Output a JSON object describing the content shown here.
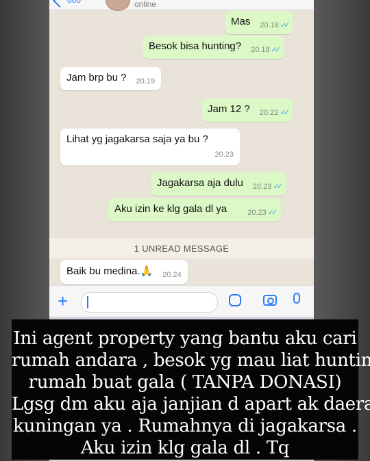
{
  "header": {
    "contact_name_stub": "000",
    "status": "online"
  },
  "messages": [
    {
      "id": "m1",
      "direction": "out",
      "text": "Mas",
      "time": "20.18",
      "read": true
    },
    {
      "id": "m2",
      "direction": "out",
      "text": "Besok bisa hunting?",
      "time": "20.18",
      "read": true
    },
    {
      "id": "m3",
      "direction": "in",
      "text": "Jam brp bu ?",
      "time": "20.19"
    },
    {
      "id": "m4",
      "direction": "out",
      "text": "Jam 12 ?",
      "time": "20.22",
      "read": true
    },
    {
      "id": "m5",
      "direction": "in",
      "text": "Lihat yg jagakarsa saja ya bu ?",
      "time": "20.23"
    },
    {
      "id": "m6",
      "direction": "out",
      "text": "Jagakarsa aja dulu",
      "time": "20.23",
      "read": true
    },
    {
      "id": "m7",
      "direction": "out",
      "text": "Aku izin ke klg gala dl ya",
      "time": "20.23",
      "read": true
    },
    {
      "id": "m8",
      "direction": "in",
      "text": "Baik bu medina.🙏",
      "time": "20.24"
    }
  ],
  "unread_label": "1 UNREAD MESSAGE",
  "composer": {
    "input_value": ""
  },
  "caption": {
    "lines": [
      "Ini agent property yang bantu aku cari",
      "rumah andara , besok yg mau liat hunting",
      "rumah buat gala ( TANPA DONASI)",
      "Lgsg dm aku aja janjian d apart ak daerah",
      "kuningan ya . Rumahnya di jagakarsa .",
      "Aku izin klg gala dl . Tq"
    ]
  },
  "colors": {
    "outgoing_bubble": "#dcf8c6",
    "incoming_bubble": "#ffffff",
    "chat_background": "#e9e3da",
    "accent": "#2b7bf6",
    "read_ticks": "#45a7e6"
  }
}
